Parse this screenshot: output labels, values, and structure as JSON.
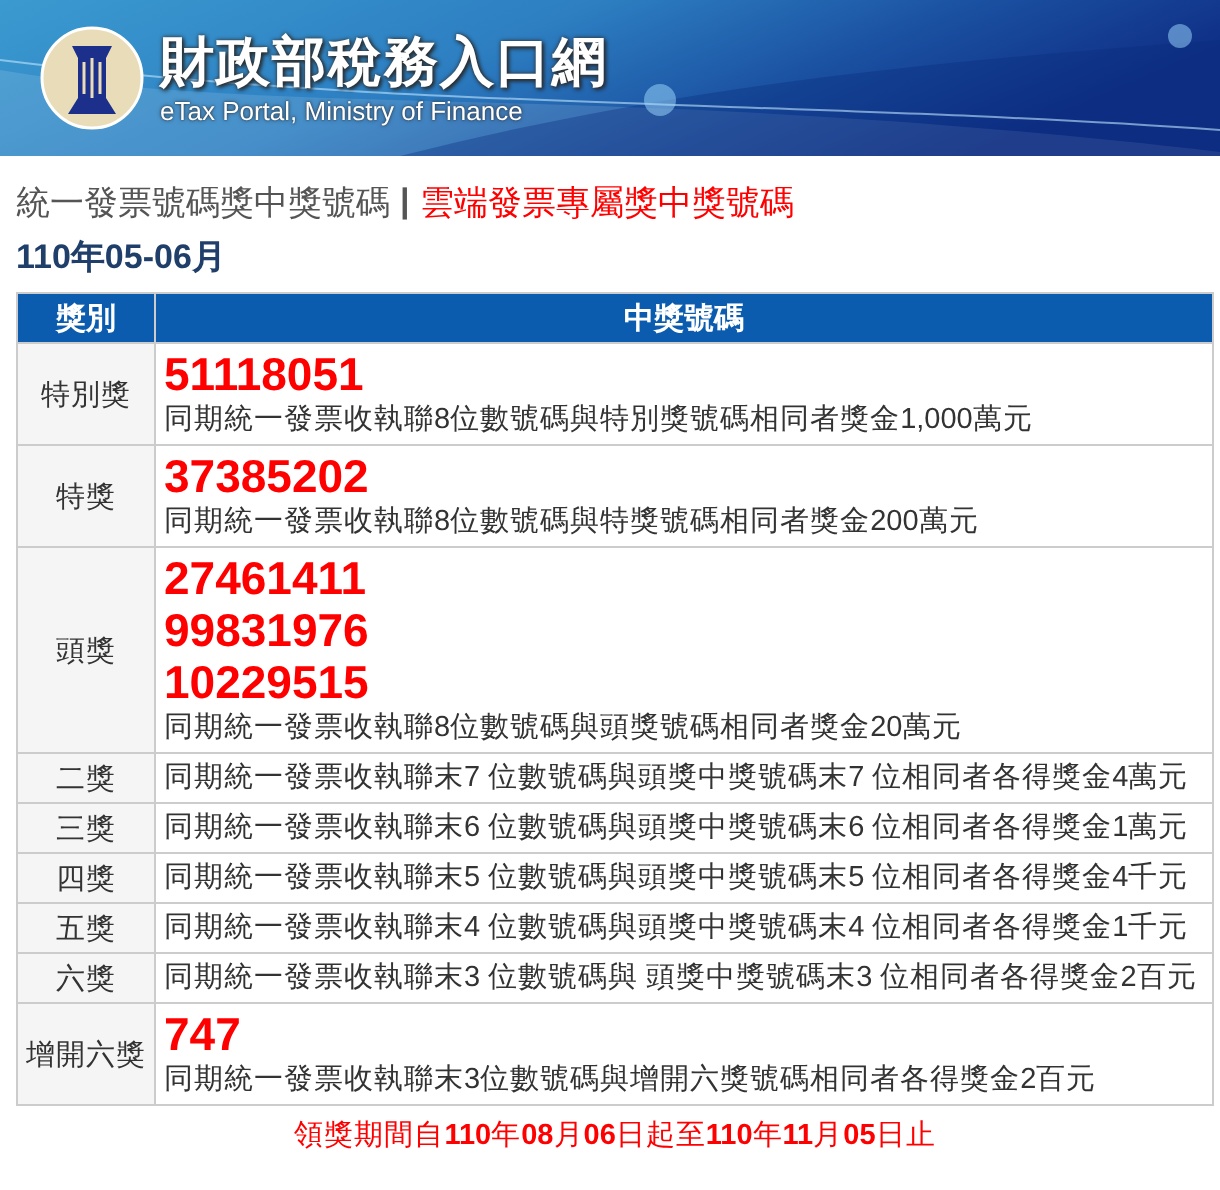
{
  "header": {
    "title": "財政部稅務入口網",
    "subtitle": "eTax Portal, Ministry of Finance"
  },
  "nav": {
    "links": [
      {
        "label": "統一發票號碼獎中獎號碼",
        "selected": true
      },
      {
        "label": "雲端發票專屬獎中獎號碼",
        "selected": false
      }
    ],
    "separator": "|"
  },
  "period": "110年05-06月",
  "table": {
    "columns": [
      "獎別",
      "中獎號碼"
    ],
    "rows": [
      {
        "prize": "特別獎",
        "numbers": [
          "51118051"
        ],
        "description": "同期統一發票收執聯8位數號碼與特別獎號碼相同者獎金1,000萬元"
      },
      {
        "prize": "特獎",
        "numbers": [
          "37385202"
        ],
        "description": "同期統一發票收執聯8位數號碼與特獎號碼相同者獎金200萬元"
      },
      {
        "prize": "頭獎",
        "numbers": [
          "27461411",
          "99831976",
          "10229515"
        ],
        "description": "同期統一發票收執聯8位數號碼與頭獎號碼相同者獎金20萬元"
      },
      {
        "prize": "二獎",
        "description": "同期統一發票收執聯末7 位數號碼與頭獎中獎號碼末7 位相同者各得獎金4萬元"
      },
      {
        "prize": "三獎",
        "description": "同期統一發票收執聯末6 位數號碼與頭獎中獎號碼末6 位相同者各得獎金1萬元"
      },
      {
        "prize": "四獎",
        "description": "同期統一發票收執聯末5 位數號碼與頭獎中獎號碼末5 位相同者各得獎金4千元"
      },
      {
        "prize": "五獎",
        "description": "同期統一發票收執聯末4 位數號碼與頭獎中獎號碼末4 位相同者各得獎金1千元"
      },
      {
        "prize": "六獎",
        "description": "同期統一發票收執聯末3 位數號碼與 頭獎中獎號碼末3 位相同者各得獎金2百元"
      },
      {
        "prize": "增開六獎",
        "numbers": [
          "747"
        ],
        "description": "同期統一發票收執聯末3位數號碼與增開六獎號碼相同者各得獎金2百元"
      }
    ]
  },
  "footer": "領獎期間自**110**年**08**月**06**日起至**110**年**11**月**05**日止"
}
